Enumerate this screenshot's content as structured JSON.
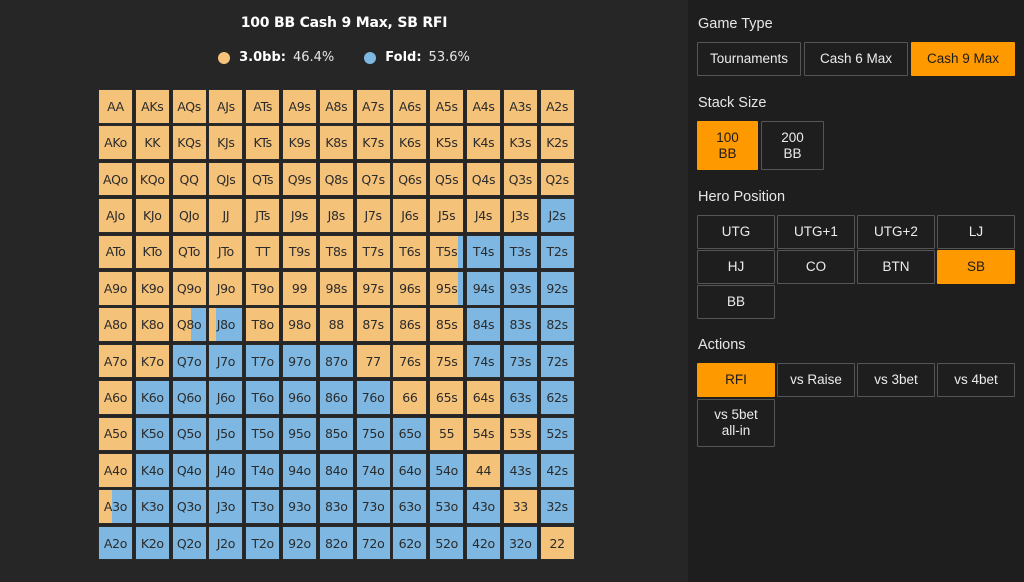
{
  "chart": {
    "title": "100 BB Cash 9 Max, SB RFI",
    "legend": [
      {
        "name": "3.0bb:",
        "pct": "46.4%",
        "color": "#f5c27a"
      },
      {
        "name": "Fold:",
        "pct": "53.6%",
        "color": "#7eb8e2"
      }
    ],
    "colors": {
      "raise": "#f5c27a",
      "fold": "#7eb8e2"
    },
    "hands": [
      [
        "AA",
        "AKs",
        "AQs",
        "AJs",
        "ATs",
        "A9s",
        "A8s",
        "A7s",
        "A6s",
        "A5s",
        "A4s",
        "A3s",
        "A2s"
      ],
      [
        "AKo",
        "KK",
        "KQs",
        "KJs",
        "KTs",
        "K9s",
        "K8s",
        "K7s",
        "K6s",
        "K5s",
        "K4s",
        "K3s",
        "K2s"
      ],
      [
        "AQo",
        "KQo",
        "QQ",
        "QJs",
        "QTs",
        "Q9s",
        "Q8s",
        "Q7s",
        "Q6s",
        "Q5s",
        "Q4s",
        "Q3s",
        "Q2s"
      ],
      [
        "AJo",
        "KJo",
        "QJo",
        "JJ",
        "JTs",
        "J9s",
        "J8s",
        "J7s",
        "J6s",
        "J5s",
        "J4s",
        "J3s",
        "J2s"
      ],
      [
        "ATo",
        "KTo",
        "QTo",
        "JTo",
        "TT",
        "T9s",
        "T8s",
        "T7s",
        "T6s",
        "T5s",
        "T4s",
        "T3s",
        "T2s"
      ],
      [
        "A9o",
        "K9o",
        "Q9o",
        "J9o",
        "T9o",
        "99",
        "98s",
        "97s",
        "96s",
        "95s",
        "94s",
        "93s",
        "92s"
      ],
      [
        "A8o",
        "K8o",
        "Q8o",
        "J8o",
        "T8o",
        "98o",
        "88",
        "87s",
        "86s",
        "85s",
        "84s",
        "83s",
        "82s"
      ],
      [
        "A7o",
        "K7o",
        "Q7o",
        "J7o",
        "T7o",
        "97o",
        "87o",
        "77",
        "76s",
        "75s",
        "74s",
        "73s",
        "72s"
      ],
      [
        "A6o",
        "K6o",
        "Q6o",
        "J6o",
        "T6o",
        "96o",
        "86o",
        "76o",
        "66",
        "65s",
        "64s",
        "63s",
        "62s"
      ],
      [
        "A5o",
        "K5o",
        "Q5o",
        "J5o",
        "T5o",
        "95o",
        "85o",
        "75o",
        "65o",
        "55",
        "54s",
        "53s",
        "52s"
      ],
      [
        "A4o",
        "K4o",
        "Q4o",
        "J4o",
        "T4o",
        "94o",
        "84o",
        "74o",
        "64o",
        "54o",
        "44",
        "43s",
        "42s"
      ],
      [
        "A3o",
        "K3o",
        "Q3o",
        "J3o",
        "T3o",
        "93o",
        "83o",
        "73o",
        "63o",
        "53o",
        "43o",
        "33",
        "32s"
      ],
      [
        "A2o",
        "K2o",
        "Q2o",
        "J2o",
        "T2o",
        "92o",
        "82o",
        "72o",
        "62o",
        "52o",
        "42o",
        "32o",
        "22"
      ]
    ],
    "raise_freq": [
      [
        1,
        1,
        1,
        1,
        1,
        1,
        1,
        1,
        1,
        1,
        1,
        1,
        1
      ],
      [
        1,
        1,
        1,
        1,
        1,
        1,
        1,
        1,
        1,
        1,
        1,
        1,
        1
      ],
      [
        1,
        1,
        1,
        1,
        1,
        1,
        1,
        1,
        1,
        1,
        1,
        1,
        1
      ],
      [
        1,
        1,
        1,
        1,
        1,
        1,
        1,
        1,
        1,
        1,
        1,
        1,
        0
      ],
      [
        1,
        1,
        1,
        1,
        1,
        1,
        1,
        1,
        1,
        0.85,
        0,
        0,
        0
      ],
      [
        1,
        1,
        1,
        1,
        1,
        1,
        1,
        1,
        1,
        0.85,
        0,
        0,
        0
      ],
      [
        1,
        1,
        0.55,
        0.2,
        1,
        1,
        1,
        1,
        1,
        1,
        0,
        0,
        0
      ],
      [
        1,
        1,
        0,
        0,
        0,
        0,
        0,
        1,
        1,
        1,
        0,
        0,
        0
      ],
      [
        1,
        0,
        0,
        0,
        0,
        0,
        0,
        0,
        1,
        1,
        1,
        0,
        0
      ],
      [
        1,
        0,
        0,
        0,
        0,
        0,
        0,
        0,
        0,
        1,
        1,
        1,
        0
      ],
      [
        1,
        0,
        0,
        0,
        0,
        0,
        0,
        0,
        0,
        0,
        1,
        0,
        0
      ],
      [
        0.4,
        0,
        0,
        0,
        0,
        0,
        0,
        0,
        0,
        0,
        0,
        1,
        0
      ],
      [
        0,
        0,
        0,
        0,
        0,
        0,
        0,
        0,
        0,
        0,
        0,
        0,
        1
      ]
    ]
  },
  "controls": {
    "game_type": {
      "title": "Game Type",
      "options": [
        "Tournaments",
        "Cash 6 Max",
        "Cash 9 Max"
      ],
      "selected": "Cash 9 Max"
    },
    "stack_size": {
      "title": "Stack Size",
      "options": [
        "100\nBB",
        "200\nBB"
      ],
      "selected": "100\nBB"
    },
    "hero_position": {
      "title": "Hero Position",
      "options": [
        "UTG",
        "UTG+1",
        "UTG+2",
        "LJ",
        "HJ",
        "CO",
        "BTN",
        "SB",
        "BB"
      ],
      "selected": "SB"
    },
    "actions": {
      "title": "Actions",
      "options": [
        "RFI",
        "vs Raise",
        "vs 3bet",
        "vs 4bet",
        "vs 5bet\nall-in"
      ],
      "selected": "RFI"
    }
  }
}
